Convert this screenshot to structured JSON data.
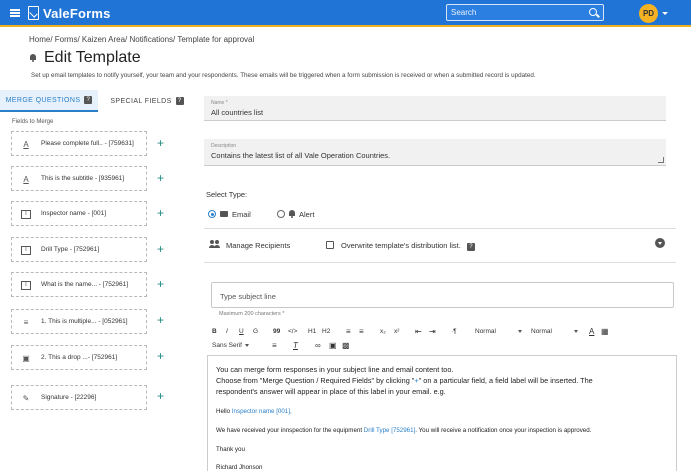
{
  "header": {
    "app_title": "ValeForms",
    "search_placeholder": "Search",
    "user_initials": "PD"
  },
  "breadcrumb": "Home/ Forms/ Kaizen Area/ Notifications/ Template for approval",
  "page": {
    "title": "Edit Template",
    "description": "Set up email templates to notify yourself, your team and your respondents. These emails will be triggered when a form submission is received or when a submitted record is updated."
  },
  "left_panel": {
    "tabs": [
      {
        "label": "MERGE QUESTIONS",
        "active": true
      },
      {
        "label": "SPECIAL FIELDS",
        "active": false
      }
    ],
    "fields_label": "Fields to Merge",
    "fields": [
      {
        "icon": "text-underline-icon",
        "label": "Please complete full.. - [759631]"
      },
      {
        "icon": "text-underline-icon",
        "label": "This is the subtitle - [935961]"
      },
      {
        "icon": "text-field-icon",
        "label": "Inspector name - [001]"
      },
      {
        "icon": "text-field-icon",
        "label": "Drill Type - [752961]"
      },
      {
        "icon": "text-field-icon",
        "label": "What is the name... - [752961]"
      },
      {
        "icon": "checklist-icon",
        "label": "1. This is multiple... - [052961]"
      },
      {
        "icon": "dropdown-icon",
        "label": "2. This a drop ...- [752961]"
      },
      {
        "icon": "signature-icon",
        "label": "Signature - [22296]"
      }
    ]
  },
  "form": {
    "name_label": "Name *",
    "name_value": "All countries list",
    "description_label": "Description",
    "description_value": "Contains the latest list of all Vale Operation Countries.",
    "select_type_label": "Select Type:",
    "type_options": [
      {
        "label": "Email",
        "checked": true
      },
      {
        "label": "Alert",
        "checked": false
      }
    ],
    "manage_recipients_label": "Manage Recipients",
    "overwrite_label": "Overwrite template's  distribution list.",
    "subject_placeholder": "Type subject line",
    "max_chars_label": "Maximum 200 characters *"
  },
  "toolbar": {
    "bold": "B",
    "italic": "I",
    "underline": "U",
    "strike": "G",
    "quote": "99",
    "code": "</>",
    "h1": "H1",
    "h2": "H2",
    "subscript": "x₂",
    "superscript": "x²",
    "paragraph": "¶",
    "size_1": "Normal",
    "size_2": "Normal",
    "font": "Sans Serif"
  },
  "editor": {
    "line1": "You can merge form responses in your subject line and email content too.",
    "line2_pre": "Choose from \"Merge Question / Required Fields\" by clicking \"",
    "line2_plus": "+",
    "line2_post": "\" on a particular field, a field label will be inserted. The",
    "line3": "respondent's answer will appear in place of this label in your email. e.g.",
    "hello_pre": "Hello ",
    "hello_field": "Inspector name [001],",
    "received_pre": "We have received your innspection for the equipment ",
    "received_field": "Drill Type [752961]",
    "received_post": ". You will receive a notification once your inspection is approved.",
    "thanks": "Thank you",
    "signature": "Richard Jhonson"
  },
  "colors": {
    "topbar": "#1f74d6",
    "accent_border": "#f2b21c",
    "avatar": "#f5b323",
    "link": "#2a7fc9",
    "plus": "#1f8a80"
  }
}
